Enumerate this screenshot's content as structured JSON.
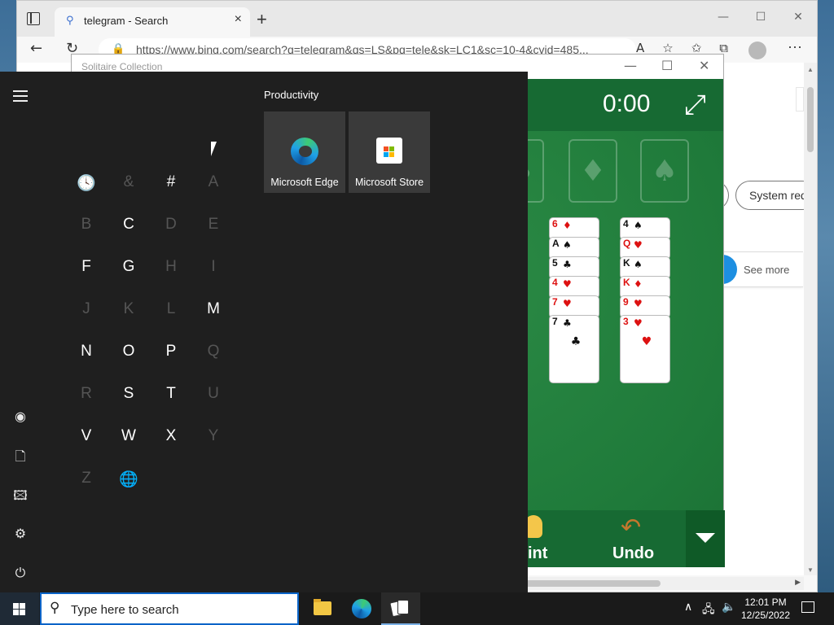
{
  "browser": {
    "tab_title": "telegram - Search",
    "url": "https://www.bing.com/search?q=telegram&qs=LS&pq=tele&sk=LC1&sc=10-4&cvid=485...",
    "chip_label": "System req",
    "see_more": "See more"
  },
  "solitaire": {
    "title": "Solitaire Collection",
    "timer": "0:00",
    "hint_label": "int",
    "undo_label": "Undo",
    "foundations": [
      "♣",
      "♦",
      "♠"
    ],
    "tableau": [
      {
        "cards": [
          {
            "rank": "6",
            "suit": "♦",
            "color": "red"
          },
          {
            "rank": "A",
            "suit": "♠",
            "color": "black"
          },
          {
            "rank": "5",
            "suit": "♣",
            "color": "black"
          },
          {
            "rank": "4",
            "suit": "♥",
            "color": "red"
          },
          {
            "rank": "7",
            "suit": "♥",
            "color": "red"
          },
          {
            "rank": "7",
            "suit": "♣",
            "color": "black"
          }
        ]
      },
      {
        "cards": [
          {
            "rank": "4",
            "suit": "♠",
            "color": "black"
          },
          {
            "rank": "Q",
            "suit": "♥",
            "color": "red"
          },
          {
            "rank": "K",
            "suit": "♠",
            "color": "black"
          },
          {
            "rank": "K",
            "suit": "♦",
            "color": "red"
          },
          {
            "rank": "9",
            "suit": "♥",
            "color": "red"
          },
          {
            "rank": "3",
            "suit": "♥",
            "color": "red"
          }
        ]
      }
    ]
  },
  "start_menu": {
    "group_title": "Productivity",
    "tiles": [
      {
        "label": "Microsoft Edge",
        "icon": "edge-icon"
      },
      {
        "label": "Microsoft Store",
        "icon": "store-icon"
      }
    ],
    "letters": [
      {
        "label": "🕓",
        "enabled": true,
        "kind": "recent-icon"
      },
      {
        "label": "&",
        "enabled": false
      },
      {
        "label": "#",
        "enabled": true
      },
      {
        "label": "A",
        "enabled": false
      },
      {
        "label": "B",
        "enabled": false
      },
      {
        "label": "C",
        "enabled": true
      },
      {
        "label": "D",
        "enabled": false
      },
      {
        "label": "E",
        "enabled": false
      },
      {
        "label": "F",
        "enabled": true
      },
      {
        "label": "G",
        "enabled": true
      },
      {
        "label": "H",
        "enabled": false
      },
      {
        "label": "I",
        "enabled": false
      },
      {
        "label": "J",
        "enabled": false
      },
      {
        "label": "K",
        "enabled": false
      },
      {
        "label": "L",
        "enabled": false
      },
      {
        "label": "M",
        "enabled": true
      },
      {
        "label": "N",
        "enabled": true
      },
      {
        "label": "O",
        "enabled": true
      },
      {
        "label": "P",
        "enabled": true
      },
      {
        "label": "Q",
        "enabled": false
      },
      {
        "label": "R",
        "enabled": false
      },
      {
        "label": "S",
        "enabled": true
      },
      {
        "label": "T",
        "enabled": true
      },
      {
        "label": "U",
        "enabled": false
      },
      {
        "label": "V",
        "enabled": true
      },
      {
        "label": "W",
        "enabled": true
      },
      {
        "label": "X",
        "enabled": true
      },
      {
        "label": "Y",
        "enabled": false
      },
      {
        "label": "Z",
        "enabled": false
      },
      {
        "label": "🌐",
        "enabled": false,
        "kind": "globe-icon"
      }
    ]
  },
  "taskbar": {
    "search_placeholder": "Type here to search",
    "time": "12:01 PM",
    "date": "12/25/2022"
  }
}
